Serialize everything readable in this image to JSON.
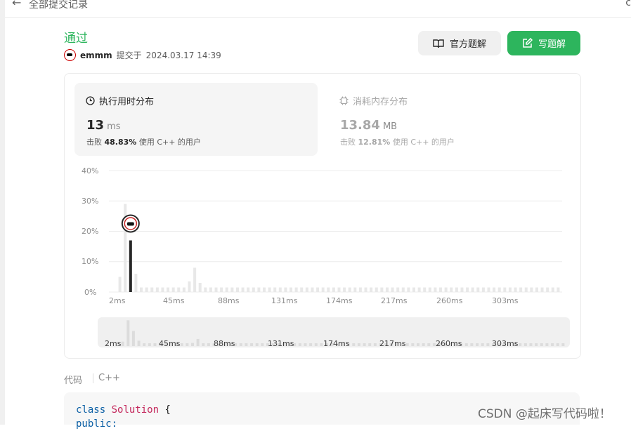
{
  "topbar": {
    "back_icon": "arrow-left-icon",
    "title": "全部提交记录",
    "right_glyph": "c"
  },
  "submission": {
    "status": "通过",
    "username": "emmm",
    "submitted_at_prefix": "提交于",
    "submitted_at": "2024.03.17 14:39"
  },
  "buttons": {
    "official": "官方题解",
    "write": "写题解"
  },
  "runtime": {
    "title": "执行用时分布",
    "value": "13",
    "unit": "ms",
    "beat_prefix": "击败",
    "beat": "48.83%",
    "beat_suffix": "使用 C++ 的用户"
  },
  "memory": {
    "title": "消耗内存分布",
    "value": "13.84",
    "unit": "MB",
    "beat_prefix": "击败",
    "beat": "12.81%",
    "beat_suffix": "使用 C++ 的用户"
  },
  "chart_data": {
    "type": "bar",
    "title": "",
    "xlabel": "",
    "ylabel": "",
    "y_ticks": [
      "40%",
      "30%",
      "20%",
      "10%",
      "0%"
    ],
    "ylim": [
      0,
      40
    ],
    "x_ticks": [
      "2ms",
      "45ms",
      "88ms",
      "131ms",
      "174ms",
      "217ms",
      "260ms",
      "303ms"
    ],
    "bin_start_ms": 2,
    "bin_width_ms": 5.4,
    "bin_count": 84,
    "values": [
      0,
      5,
      29,
      17,
      6,
      1.5,
      1.5,
      1.5,
      1.5,
      1.5,
      1.5,
      1.5,
      1.5,
      1.5,
      3.5,
      8,
      3,
      1.5,
      1.5,
      1.5,
      1.5,
      1.5,
      1.5,
      1.5,
      1.5,
      1.5,
      1.5,
      1.5,
      1.5,
      1.5,
      1.5,
      1.5,
      1.5,
      1.5,
      1.5,
      1.5,
      1.5,
      1.5,
      1.5,
      1.5,
      1.5,
      1.5,
      1.5,
      1.5,
      1.5,
      1.5,
      1.5,
      1.5,
      1.5,
      1.5,
      1.5,
      1.5,
      1.5,
      1.5,
      1.5,
      1.5,
      1.5,
      1.5,
      1.5,
      1.5,
      1.5,
      1.5,
      1.5,
      1.5,
      1.5,
      1.5,
      1.5,
      1.5,
      1.5,
      1.5,
      1.5,
      1.5,
      1.5,
      1.5,
      1.5,
      1.5,
      1.5,
      1.5,
      1.5,
      1.5,
      1.5,
      1.5,
      1.5,
      1.5
    ],
    "highlight_index": 3,
    "highlight_color": "#262626",
    "bar_color": "#e8e8e8",
    "grid": true
  },
  "code_section": {
    "label": "代码",
    "lang": "C++",
    "line1_kw": "class",
    "line1_name": "Solution",
    "line1_brace": " {",
    "line2": "public:"
  },
  "colors": {
    "accent": "#2db55d",
    "text": "#262626",
    "muted": "#8c8c8c"
  },
  "watermark": "CSDN @起床写代码啦！"
}
